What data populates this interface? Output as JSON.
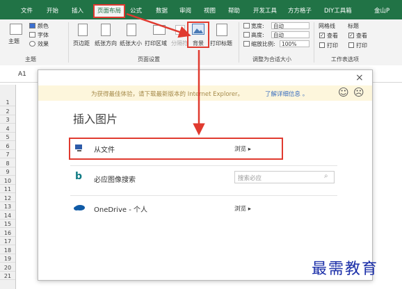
{
  "tabs": {
    "file": "文件",
    "home": "开始",
    "insert": "插入",
    "page_layout": "页面布局",
    "formulas": "公式",
    "data": "数据",
    "review": "审阅",
    "view": "视图",
    "help": "帮助",
    "developer": "开发工具",
    "fangfang": "方方格子",
    "diy": "DIY工具箱",
    "jinshan": "金山P"
  },
  "ribbon": {
    "themes": {
      "theme_btn": "主题",
      "colors": "颜色",
      "fonts": "字体",
      "effects": "效果",
      "group": "主题"
    },
    "page_setup": {
      "margins": "页边距",
      "orientation": "纸张方向",
      "size": "纸张大小",
      "print_area": "打印区域",
      "breaks": "分隔符",
      "background": "背景",
      "print_titles": "打印标题",
      "group": "页面设置"
    },
    "scale_to_fit": {
      "width_label": "宽度:",
      "width_value": "自动",
      "height_label": "高度:",
      "height_value": "自动",
      "scale_label": "缩放比例:",
      "scale_value": "100%",
      "group": "调整为合适大小"
    },
    "sheet_options": {
      "gridlines": "网格线",
      "headings": "标题",
      "view": "查看",
      "print": "打印",
      "check": "✓",
      "group": "工作表选项"
    }
  },
  "name_box": "A1",
  "row_numbers": [
    "1",
    "2",
    "3",
    "4",
    "5",
    "6",
    "7",
    "8",
    "9",
    "10",
    "11",
    "12",
    "13",
    "14",
    "15",
    "16",
    "17",
    "18",
    "19",
    "20",
    "21"
  ],
  "dialog": {
    "close": "×",
    "notice": "为获得最佳体验，请下载最新版本的 Internet Explorer。",
    "notice_link": "了解详细信息 。",
    "smile": "☺",
    "frown": "☹",
    "title": "插入图片",
    "options": [
      {
        "label": "从文件",
        "action": "浏览 ▸"
      },
      {
        "label": "必应图像搜索",
        "action": "搜索必应"
      },
      {
        "label": "OneDrive - 个人",
        "action": "浏览 ▸"
      }
    ]
  },
  "watermark": "最需教育",
  "colors": {
    "excel_green": "#217346",
    "highlight_red": "#e03a2f",
    "notice_yellow": "#fdf6dc",
    "onedrive_blue": "#0f5aa6"
  }
}
